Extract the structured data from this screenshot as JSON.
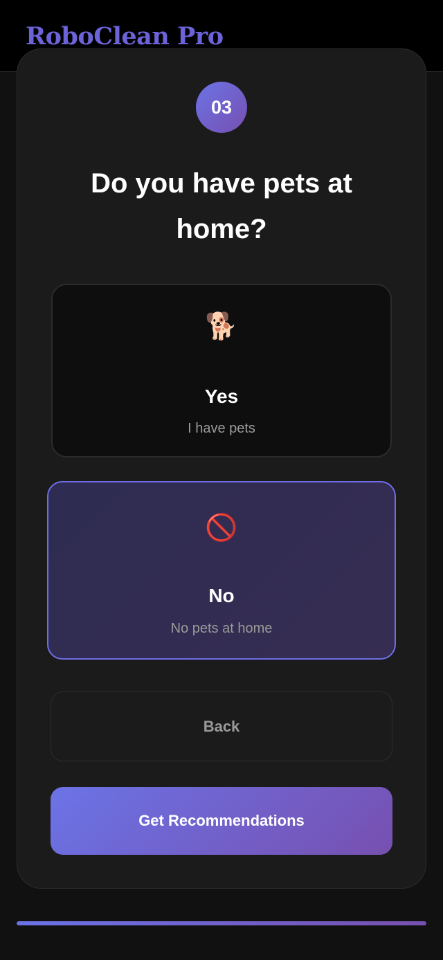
{
  "app": {
    "title": "RoboClean Pro"
  },
  "step": {
    "number": "03"
  },
  "question": {
    "text": "Do you have pets at home?"
  },
  "options": [
    {
      "icon": "dog-icon",
      "emoji": "🐕",
      "title": "Yes",
      "subtitle": "I have pets",
      "selected": false
    },
    {
      "icon": "prohibited-icon",
      "emoji": "🚫",
      "title": "No",
      "subtitle": "No pets at home",
      "selected": true
    }
  ],
  "actions": {
    "back_label": "Back",
    "primary_label": "Get Recommendations"
  },
  "progress": {
    "fraction": 1.0
  },
  "colors": {
    "accent_start": "#6b73e6",
    "accent_end": "#7750b0",
    "background": "#111111"
  }
}
